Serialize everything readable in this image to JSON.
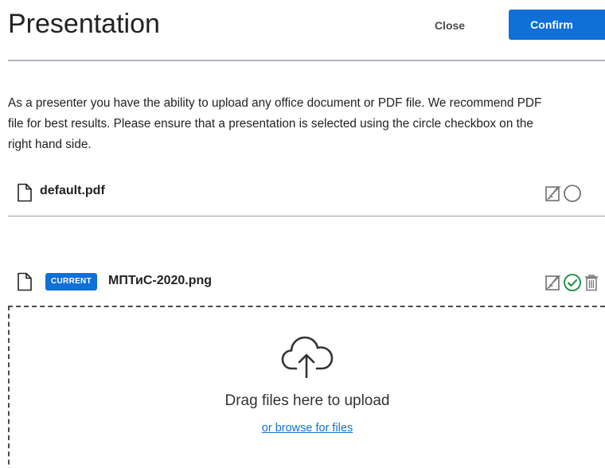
{
  "header": {
    "title": "Presentation",
    "close_label": "Close",
    "confirm_label": "Confirm"
  },
  "description": {
    "line1": "As a presenter you have the ability to upload any office document or PDF file. We recommend PDF",
    "line2": "file for best results. Please ensure that a presentation is selected using the circle checkbox on the",
    "line3": "right hand side."
  },
  "files": [
    {
      "name": "default.pdf",
      "current": false,
      "icons": [
        "document-icon",
        "annotation-toggle-icon",
        "select-circle-icon"
      ]
    },
    {
      "name": "МПТиС-2020.png",
      "current": true,
      "badge": "CURRENT",
      "icons": [
        "document-icon",
        "annotation-toggle-icon",
        "selected-check-icon",
        "trash-icon"
      ]
    }
  ],
  "upload": {
    "drag_text": "Drag files here to upload",
    "browse_text": "or browse for files",
    "icon": "cloud-upload-icon"
  },
  "colors": {
    "accent": "#0f70d7",
    "selected_green": "#138a3f",
    "divider": "#b0b6bf",
    "text": "#222222"
  }
}
